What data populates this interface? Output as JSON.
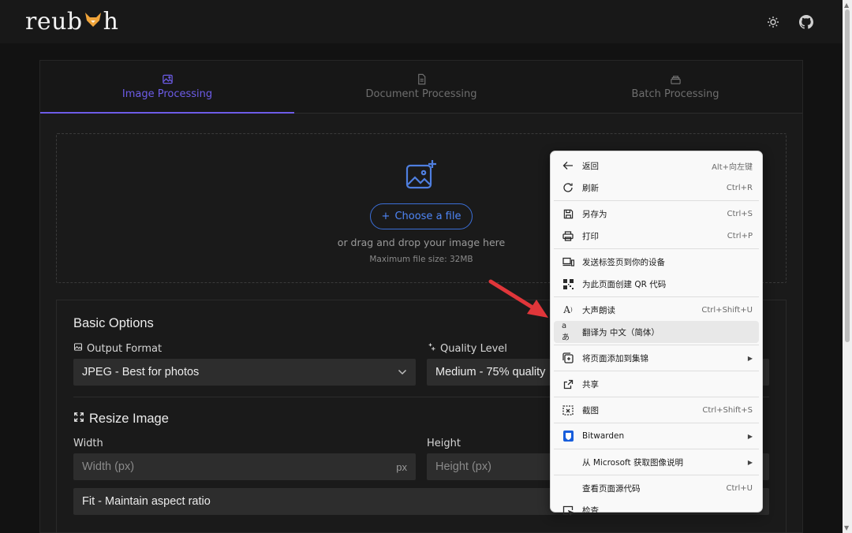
{
  "app": {
    "logo_left": "reub",
    "logo_right": "h",
    "icons": [
      "sun-icon",
      "github-icon"
    ]
  },
  "tabs": [
    {
      "label": "Image Processing",
      "icon": "image-icon",
      "active": true
    },
    {
      "label": "Document Processing",
      "icon": "document-icon",
      "active": false
    },
    {
      "label": "Batch Processing",
      "icon": "batch-icon",
      "active": false
    }
  ],
  "dropzone": {
    "choose_label": "Choose a file",
    "drag_text": "or drag and drop your image here",
    "max_size": "Maximum file size: 32MB"
  },
  "basic_options": {
    "title": "Basic Options",
    "output_format": {
      "label": "Output Format",
      "value": "JPEG - Best for photos"
    },
    "quality_level": {
      "label": "Quality Level",
      "value": "Medium - 75% quality"
    }
  },
  "resize": {
    "title": "Resize Image",
    "width": {
      "label": "Width",
      "placeholder": "Width (px)",
      "unit": "px"
    },
    "height": {
      "label": "Height",
      "placeholder": "Height (px)"
    },
    "fit_mode": "Fit - Maintain aspect ratio"
  },
  "context_menu": {
    "items": [
      {
        "label": "返回",
        "shortcut": "Alt+向左键",
        "icon": "back-arrow-icon"
      },
      {
        "label": "刷新",
        "shortcut": "Ctrl+R",
        "icon": "refresh-icon"
      },
      {
        "label": "另存为",
        "shortcut": "Ctrl+S",
        "icon": "save-icon"
      },
      {
        "label": "打印",
        "shortcut": "Ctrl+P",
        "icon": "print-icon"
      },
      {
        "label": "发送标签页到你的设备",
        "shortcut": "",
        "icon": "send-device-icon"
      },
      {
        "label": "为此页面创建 QR 代码",
        "shortcut": "",
        "icon": "qr-code-icon"
      },
      {
        "label": "大声朗读",
        "shortcut": "Ctrl+Shift+U",
        "icon": "read-aloud-icon"
      },
      {
        "label": "翻译为 中文（简体）",
        "shortcut": "",
        "icon": "translate-icon"
      },
      {
        "label": "将页面添加到集锦",
        "shortcut": "",
        "icon": "collections-icon"
      },
      {
        "label": "共享",
        "shortcut": "",
        "icon": "share-icon"
      },
      {
        "label": "截图",
        "shortcut": "Ctrl+Shift+S",
        "icon": "screenshot-icon"
      },
      {
        "label": "Bitwarden",
        "shortcut": "",
        "icon": "bitwarden-icon"
      },
      {
        "label": "从 Microsoft 获取图像说明",
        "shortcut": "",
        "icon": ""
      },
      {
        "label": "查看页面源代码",
        "shortcut": "Ctrl+U",
        "icon": ""
      },
      {
        "label": "检查",
        "shortcut": "",
        "icon": "inspect-icon"
      }
    ]
  },
  "colors": {
    "accent": "#6d5ce8",
    "link_blue": "#4f86f7",
    "annotation_arrow": "#e0363a"
  }
}
